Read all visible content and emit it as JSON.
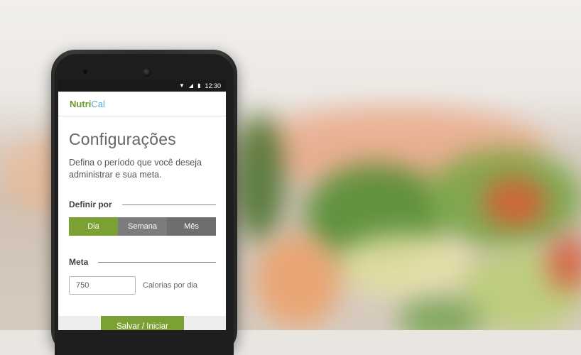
{
  "status_bar": {
    "time": "12:30",
    "wifi_icon": "wifi-icon",
    "signal_icon": "signal-icon",
    "battery_icon": "battery-icon"
  },
  "app": {
    "logo_part1": "Nutri",
    "logo_part2": "Cal"
  },
  "page": {
    "title": "Configurações",
    "description": "Defina o período que você deseja administrar e sua meta."
  },
  "period": {
    "label": "Definir por",
    "options": [
      "Dia",
      "Semana",
      "Mês"
    ],
    "selected": "Dia"
  },
  "goal": {
    "label": "Meta",
    "value": "750",
    "unit": "Calorias por dia"
  },
  "actions": {
    "save_label": "Salvar / Iniciar"
  },
  "colors": {
    "accent": "#7ba034",
    "logo_blue": "#5aa7cf",
    "segment": "#6e6e6e"
  }
}
